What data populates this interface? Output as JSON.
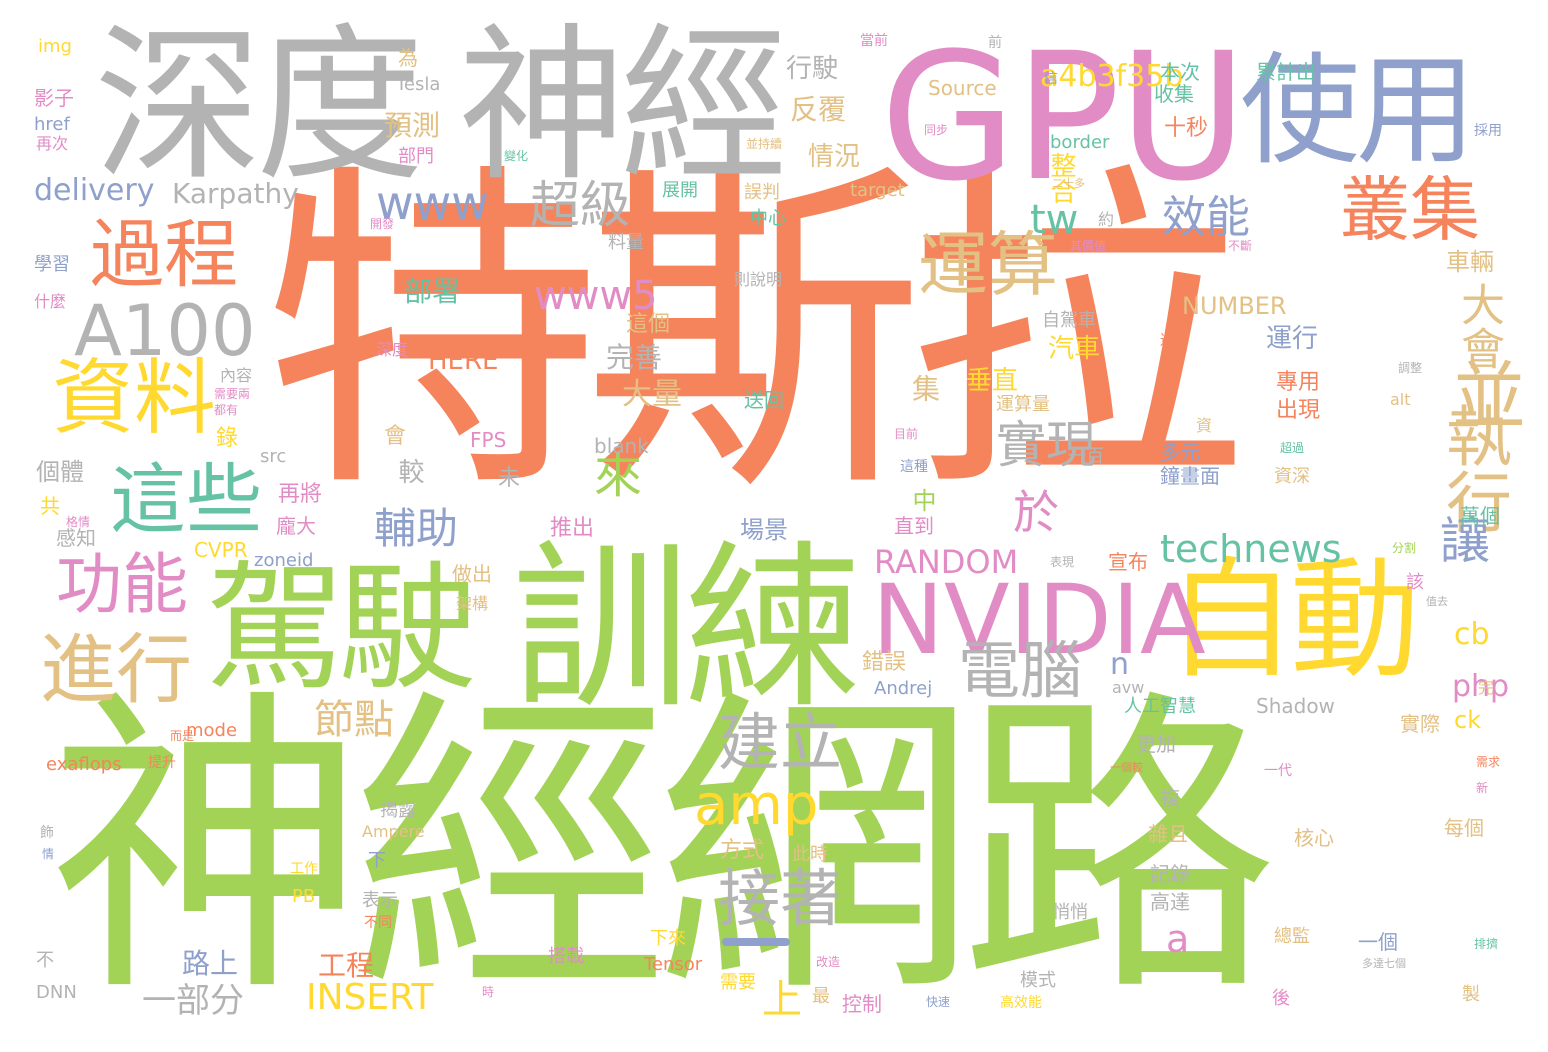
{
  "colors": {
    "orange": "#F5845C",
    "green": "#A3D356",
    "gray": "#B3B3B3",
    "pink": "#E28CC6",
    "yellow": "#FFD92F",
    "tan": "#E3C084",
    "blue": "#8EA0CB",
    "teal": "#66C2A5"
  },
  "words": [
    {
      "text": "特斯拉",
      "color": "orange"
    },
    {
      "text": "神經網路",
      "color": "green"
    },
    {
      "text": "訓練",
      "color": "green"
    },
    {
      "text": "深度",
      "color": "gray"
    },
    {
      "text": "神經",
      "color": "gray"
    },
    {
      "text": "GPU",
      "color": "pink"
    },
    {
      "text": "使用",
      "color": "blue"
    },
    {
      "text": "自動",
      "color": "yellow"
    },
    {
      "text": "駕駛",
      "color": "green"
    },
    {
      "text": "NVIDIA",
      "color": "pink"
    },
    {
      "text": "資料",
      "color": "yellow"
    },
    {
      "text": "過程",
      "color": "orange"
    },
    {
      "text": "A100",
      "color": "gray"
    },
    {
      "text": "這些",
      "color": "teal"
    },
    {
      "text": "功能",
      "color": "pink"
    },
    {
      "text": "進行",
      "color": "tan"
    },
    {
      "text": "叢集",
      "color": "orange"
    },
    {
      "text": "運算",
      "color": "tan"
    },
    {
      "text": "並",
      "color": "tan"
    },
    {
      "text": "執行",
      "color": "tan"
    },
    {
      "text": "電腦",
      "color": "gray"
    },
    {
      "text": "建立",
      "color": "gray"
    },
    {
      "text": "接著",
      "color": "gray"
    },
    {
      "text": "amp",
      "color": "yellow"
    },
    {
      "text": "超級",
      "color": "gray"
    },
    {
      "text": "www",
      "color": "blue"
    },
    {
      "text": "www5",
      "color": "pink"
    },
    {
      "text": "效能",
      "color": "blue"
    },
    {
      "text": "tw",
      "color": "teal"
    },
    {
      "text": "大會",
      "color": "tan"
    },
    {
      "text": "實現",
      "color": "gray"
    },
    {
      "text": "讓",
      "color": "blue"
    },
    {
      "text": "technews",
      "color": "teal"
    },
    {
      "text": "來",
      "color": "green"
    },
    {
      "text": "於",
      "color": "pink"
    },
    {
      "text": "輔助",
      "color": "blue"
    },
    {
      "text": "節點",
      "color": "tan"
    },
    {
      "text": "RANDOM",
      "color": "pink"
    },
    {
      "text": "a4b3f35b",
      "color": "yellow"
    },
    {
      "text": "delivery",
      "color": "blue"
    },
    {
      "text": "Karpathy",
      "color": "gray"
    },
    {
      "text": "INSERT",
      "color": "yellow"
    },
    {
      "text": "一部分",
      "color": "gray"
    },
    {
      "text": "上",
      "color": "yellow"
    },
    {
      "text": "php",
      "color": "pink"
    },
    {
      "text": "a",
      "color": "pink"
    },
    {
      "text": "n",
      "color": "blue"
    },
    {
      "text": "cb",
      "color": "yellow"
    },
    {
      "text": "行駛",
      "color": "gray"
    },
    {
      "text": "反覆",
      "color": "tan"
    },
    {
      "text": "預測",
      "color": "tan"
    },
    {
      "text": "情況",
      "color": "tan"
    },
    {
      "text": "整合",
      "color": "yellow"
    },
    {
      "text": "十秒",
      "color": "orange"
    },
    {
      "text": "收集",
      "color": "teal"
    },
    {
      "text": "本次",
      "color": "teal"
    },
    {
      "text": "累計出",
      "color": "teal"
    },
    {
      "text": "border",
      "color": "teal"
    },
    {
      "text": "Source",
      "color": "tan"
    },
    {
      "text": "Tesla",
      "color": "gray"
    },
    {
      "text": "為",
      "color": "tan"
    },
    {
      "text": "img",
      "color": "yellow"
    },
    {
      "text": "影子",
      "color": "pink"
    },
    {
      "text": "href",
      "color": "blue"
    },
    {
      "text": "再次",
      "color": "pink"
    },
    {
      "text": "部門",
      "color": "pink"
    },
    {
      "text": "學習",
      "color": "blue"
    },
    {
      "text": "什麼",
      "color": "pink"
    },
    {
      "text": "部署",
      "color": "teal"
    },
    {
      "text": "NUMBER",
      "color": "tan"
    },
    {
      "text": "自駕車",
      "color": "gray"
    },
    {
      "text": "運行",
      "color": "blue"
    },
    {
      "text": "汽車",
      "color": "yellow"
    },
    {
      "text": "HERE",
      "color": "orange"
    },
    {
      "text": "完善",
      "color": "gray"
    },
    {
      "text": "這個",
      "color": "tan"
    },
    {
      "text": "大量",
      "color": "tan"
    },
    {
      "text": "車輛",
      "color": "tan"
    },
    {
      "text": "垂直",
      "color": "yellow"
    },
    {
      "text": "集",
      "color": "tan"
    },
    {
      "text": "送回",
      "color": "teal"
    },
    {
      "text": "運算量",
      "color": "tan"
    },
    {
      "text": "專用",
      "color": "orange"
    },
    {
      "text": "出現",
      "color": "orange"
    },
    {
      "text": "多元",
      "color": "blue"
    },
    {
      "text": "鐘畫面",
      "color": "blue"
    },
    {
      "text": "資深",
      "color": "tan"
    },
    {
      "text": "一百",
      "color": "gray"
    },
    {
      "text": "較",
      "color": "gray"
    },
    {
      "text": "個體",
      "color": "gray"
    },
    {
      "text": "blank",
      "color": "gray"
    },
    {
      "text": "src",
      "color": "gray"
    },
    {
      "text": "FPS",
      "color": "pink"
    },
    {
      "text": "未",
      "color": "gray"
    },
    {
      "text": "會",
      "color": "tan"
    },
    {
      "text": "錄",
      "color": "yellow"
    },
    {
      "text": "再將",
      "color": "pink"
    },
    {
      "text": "龐大",
      "color": "pink"
    },
    {
      "text": "共",
      "color": "yellow"
    },
    {
      "text": "感知",
      "color": "gray"
    },
    {
      "text": "CVPR",
      "color": "yellow"
    },
    {
      "text": "zoneid",
      "color": "blue"
    },
    {
      "text": "推出",
      "color": "pink"
    },
    {
      "text": "中",
      "color": "green"
    },
    {
      "text": "場景",
      "color": "blue"
    },
    {
      "text": "直到",
      "color": "pink"
    },
    {
      "text": "宣布",
      "color": "orange"
    },
    {
      "text": "萬個",
      "color": "teal"
    },
    {
      "text": "該",
      "color": "pink"
    },
    {
      "text": "做出",
      "color": "tan"
    },
    {
      "text": "錯誤",
      "color": "tan"
    },
    {
      "text": "Andrej",
      "color": "blue"
    },
    {
      "text": "人工智慧",
      "color": "teal"
    },
    {
      "text": "Shadow",
      "color": "gray"
    },
    {
      "text": "實際",
      "color": "tan"
    },
    {
      "text": "ck",
      "color": "yellow"
    },
    {
      "text": "avw",
      "color": "gray"
    },
    {
      "text": "完",
      "color": "tan"
    },
    {
      "text": "mode",
      "color": "orange"
    },
    {
      "text": "exaflops",
      "color": "orange"
    },
    {
      "text": "更加",
      "color": "gray"
    },
    {
      "text": "方式",
      "color": "tan"
    },
    {
      "text": "此時",
      "color": "tan"
    },
    {
      "text": "揭露",
      "color": "gray"
    },
    {
      "text": "複",
      "color": "gray"
    },
    {
      "text": "雜且",
      "color": "tan"
    },
    {
      "text": "核心",
      "color": "tan"
    },
    {
      "text": "每個",
      "color": "tan"
    },
    {
      "text": "一代",
      "color": "pink"
    },
    {
      "text": "記錄",
      "color": "gray"
    },
    {
      "text": "高達",
      "color": "gray"
    },
    {
      "text": "Ampere",
      "color": "tan"
    },
    {
      "text": "下",
      "color": "blue"
    },
    {
      "text": "工作",
      "color": "yellow"
    },
    {
      "text": "PB",
      "color": "yellow"
    },
    {
      "text": "表示",
      "color": "gray"
    },
    {
      "text": "不同",
      "color": "orange"
    },
    {
      "text": "悄悄",
      "color": "gray"
    },
    {
      "text": "總監",
      "color": "tan"
    },
    {
      "text": "一個",
      "color": "blue"
    },
    {
      "text": "下來",
      "color": "yellow"
    },
    {
      "text": "搭載",
      "color": "pink"
    },
    {
      "text": "Tensor",
      "color": "orange"
    },
    {
      "text": "路上",
      "color": "blue"
    },
    {
      "text": "工程",
      "color": "orange"
    },
    {
      "text": "不",
      "color": "gray"
    },
    {
      "text": "DNN",
      "color": "gray"
    },
    {
      "text": "需要",
      "color": "yellow"
    },
    {
      "text": "最",
      "color": "tan"
    },
    {
      "text": "控制",
      "color": "pink"
    },
    {
      "text": "模式",
      "color": "gray"
    },
    {
      "text": "高效能",
      "color": "yellow"
    },
    {
      "text": "後",
      "color": "pink"
    },
    {
      "text": "製",
      "color": "tan"
    },
    {
      "text": "當前",
      "color": "pink"
    },
    {
      "text": "前",
      "color": "gray"
    },
    {
      "text": "信",
      "color": "blue"
    },
    {
      "text": "同步",
      "color": "pink"
    },
    {
      "text": "採用",
      "color": "blue"
    },
    {
      "text": "二十多",
      "color": "tan"
    },
    {
      "text": "target",
      "color": "tan"
    },
    {
      "text": "展開",
      "color": "teal"
    },
    {
      "text": "誤判",
      "color": "tan"
    },
    {
      "text": "中心",
      "color": "teal"
    },
    {
      "text": "約",
      "color": "gray"
    },
    {
      "text": "其價值",
      "color": "pink"
    },
    {
      "text": "不斷",
      "color": "pink"
    },
    {
      "text": "料量",
      "color": "gray"
    },
    {
      "text": "則說明",
      "color": "gray"
    },
    {
      "text": "開發",
      "color": "pink"
    },
    {
      "text": "並持續",
      "color": "tan"
    },
    {
      "text": "變化",
      "color": "teal"
    },
    {
      "text": "內容",
      "color": "gray"
    },
    {
      "text": "需要兩",
      "color": "pink"
    },
    {
      "text": "都有",
      "color": "pink"
    },
    {
      "text": "深度",
      "color": "pink"
    },
    {
      "text": "還也",
      "color": "orange"
    },
    {
      "text": "調整",
      "color": "gray"
    },
    {
      "text": "alt",
      "color": "tan"
    },
    {
      "text": "資",
      "color": "tan"
    },
    {
      "text": "目前",
      "color": "pink"
    },
    {
      "text": "這種",
      "color": "blue"
    },
    {
      "text": "超過",
      "color": "teal"
    },
    {
      "text": "分割",
      "color": "green"
    },
    {
      "text": "值去",
      "color": "gray"
    },
    {
      "text": "提升",
      "color": "orange"
    },
    {
      "text": "需求",
      "color": "orange"
    },
    {
      "text": "新",
      "color": "pink"
    },
    {
      "text": "一個較",
      "color": "orange"
    },
    {
      "text": "時",
      "color": "pink"
    },
    {
      "text": "快速",
      "color": "blue"
    },
    {
      "text": "排擠",
      "color": "teal"
    },
    {
      "text": "多達七個",
      "color": "gray"
    },
    {
      "text": "改造",
      "color": "pink"
    },
    {
      "text": "而是",
      "color": "orange"
    },
    {
      "text": "飾",
      "color": "gray"
    },
    {
      "text": "情",
      "color": "blue"
    },
    {
      "text": "架構",
      "color": "tan"
    },
    {
      "text": "表現",
      "color": "gray"
    },
    {
      "text": "格情",
      "color": "pink"
    }
  ]
}
